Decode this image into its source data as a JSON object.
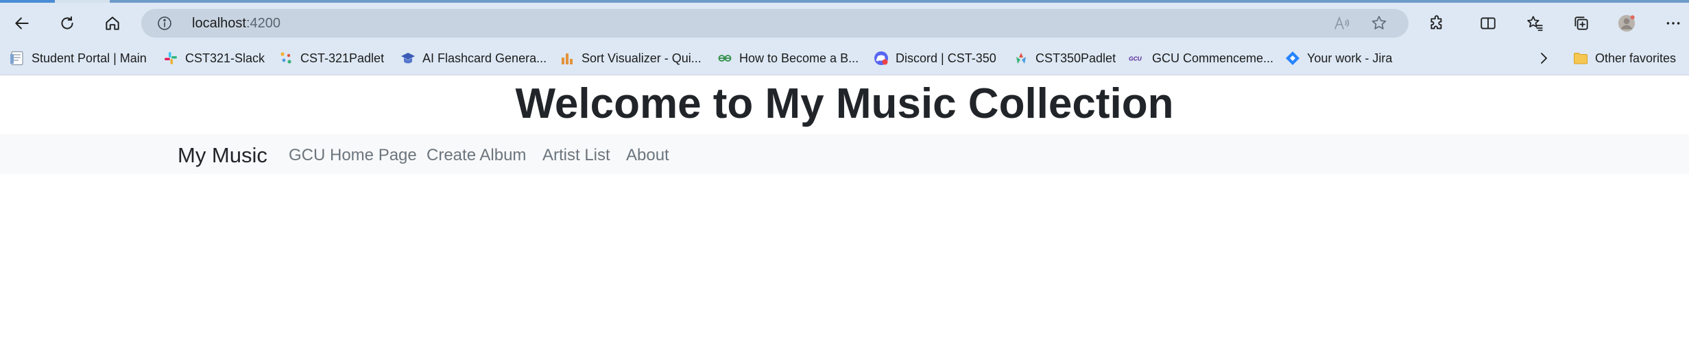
{
  "browser": {
    "address": {
      "host": "localhost",
      "port": ":4200"
    },
    "toolbar_icons": [
      "back-icon",
      "refresh-icon",
      "home-icon",
      "info-icon",
      "read-aloud-icon",
      "favorite-star-icon",
      "extensions-icon",
      "split-screen-icon",
      "favorites-icon",
      "collections-icon",
      "profile-icon",
      "more-icon"
    ],
    "bookmarks": [
      {
        "label": "Student Portal | Main",
        "icon": "doc-icon"
      },
      {
        "label": "CST321-Slack",
        "icon": "slack-icon"
      },
      {
        "label": "CST-321Padlet",
        "icon": "padlet-icon"
      },
      {
        "label": "AI Flashcard Genera...",
        "icon": "graduation-cap-icon"
      },
      {
        "label": "Sort Visualizer - Qui...",
        "icon": "bar-chart-icon"
      },
      {
        "label": "How to Become a B...",
        "icon": "gfg-icon"
      },
      {
        "label": "Discord | CST-350",
        "icon": "discord-icon"
      },
      {
        "label": "CST350Padlet",
        "icon": "padlet-icon"
      },
      {
        "label": "GCU Commenceme...",
        "icon": "gcu-icon"
      },
      {
        "label": "Your work - Jira",
        "icon": "jira-icon"
      }
    ],
    "more_bookmarks_icon": "chevron-right-icon",
    "other_favorites": "Other favorites",
    "gcu_logo_text": "GCU"
  },
  "page": {
    "title": "Welcome to My Music Collection",
    "nav": {
      "brand": "My Music",
      "links": [
        "GCU Home Page",
        "Create Album",
        "Artist List",
        "About"
      ]
    }
  },
  "colors": {
    "toolbar_bg": "#dde8f4",
    "address_bg": "#c7d3e1",
    "navbar_bg": "#f8f9fa",
    "title_color": "#212529",
    "nav_link_color": "#6c757d"
  }
}
